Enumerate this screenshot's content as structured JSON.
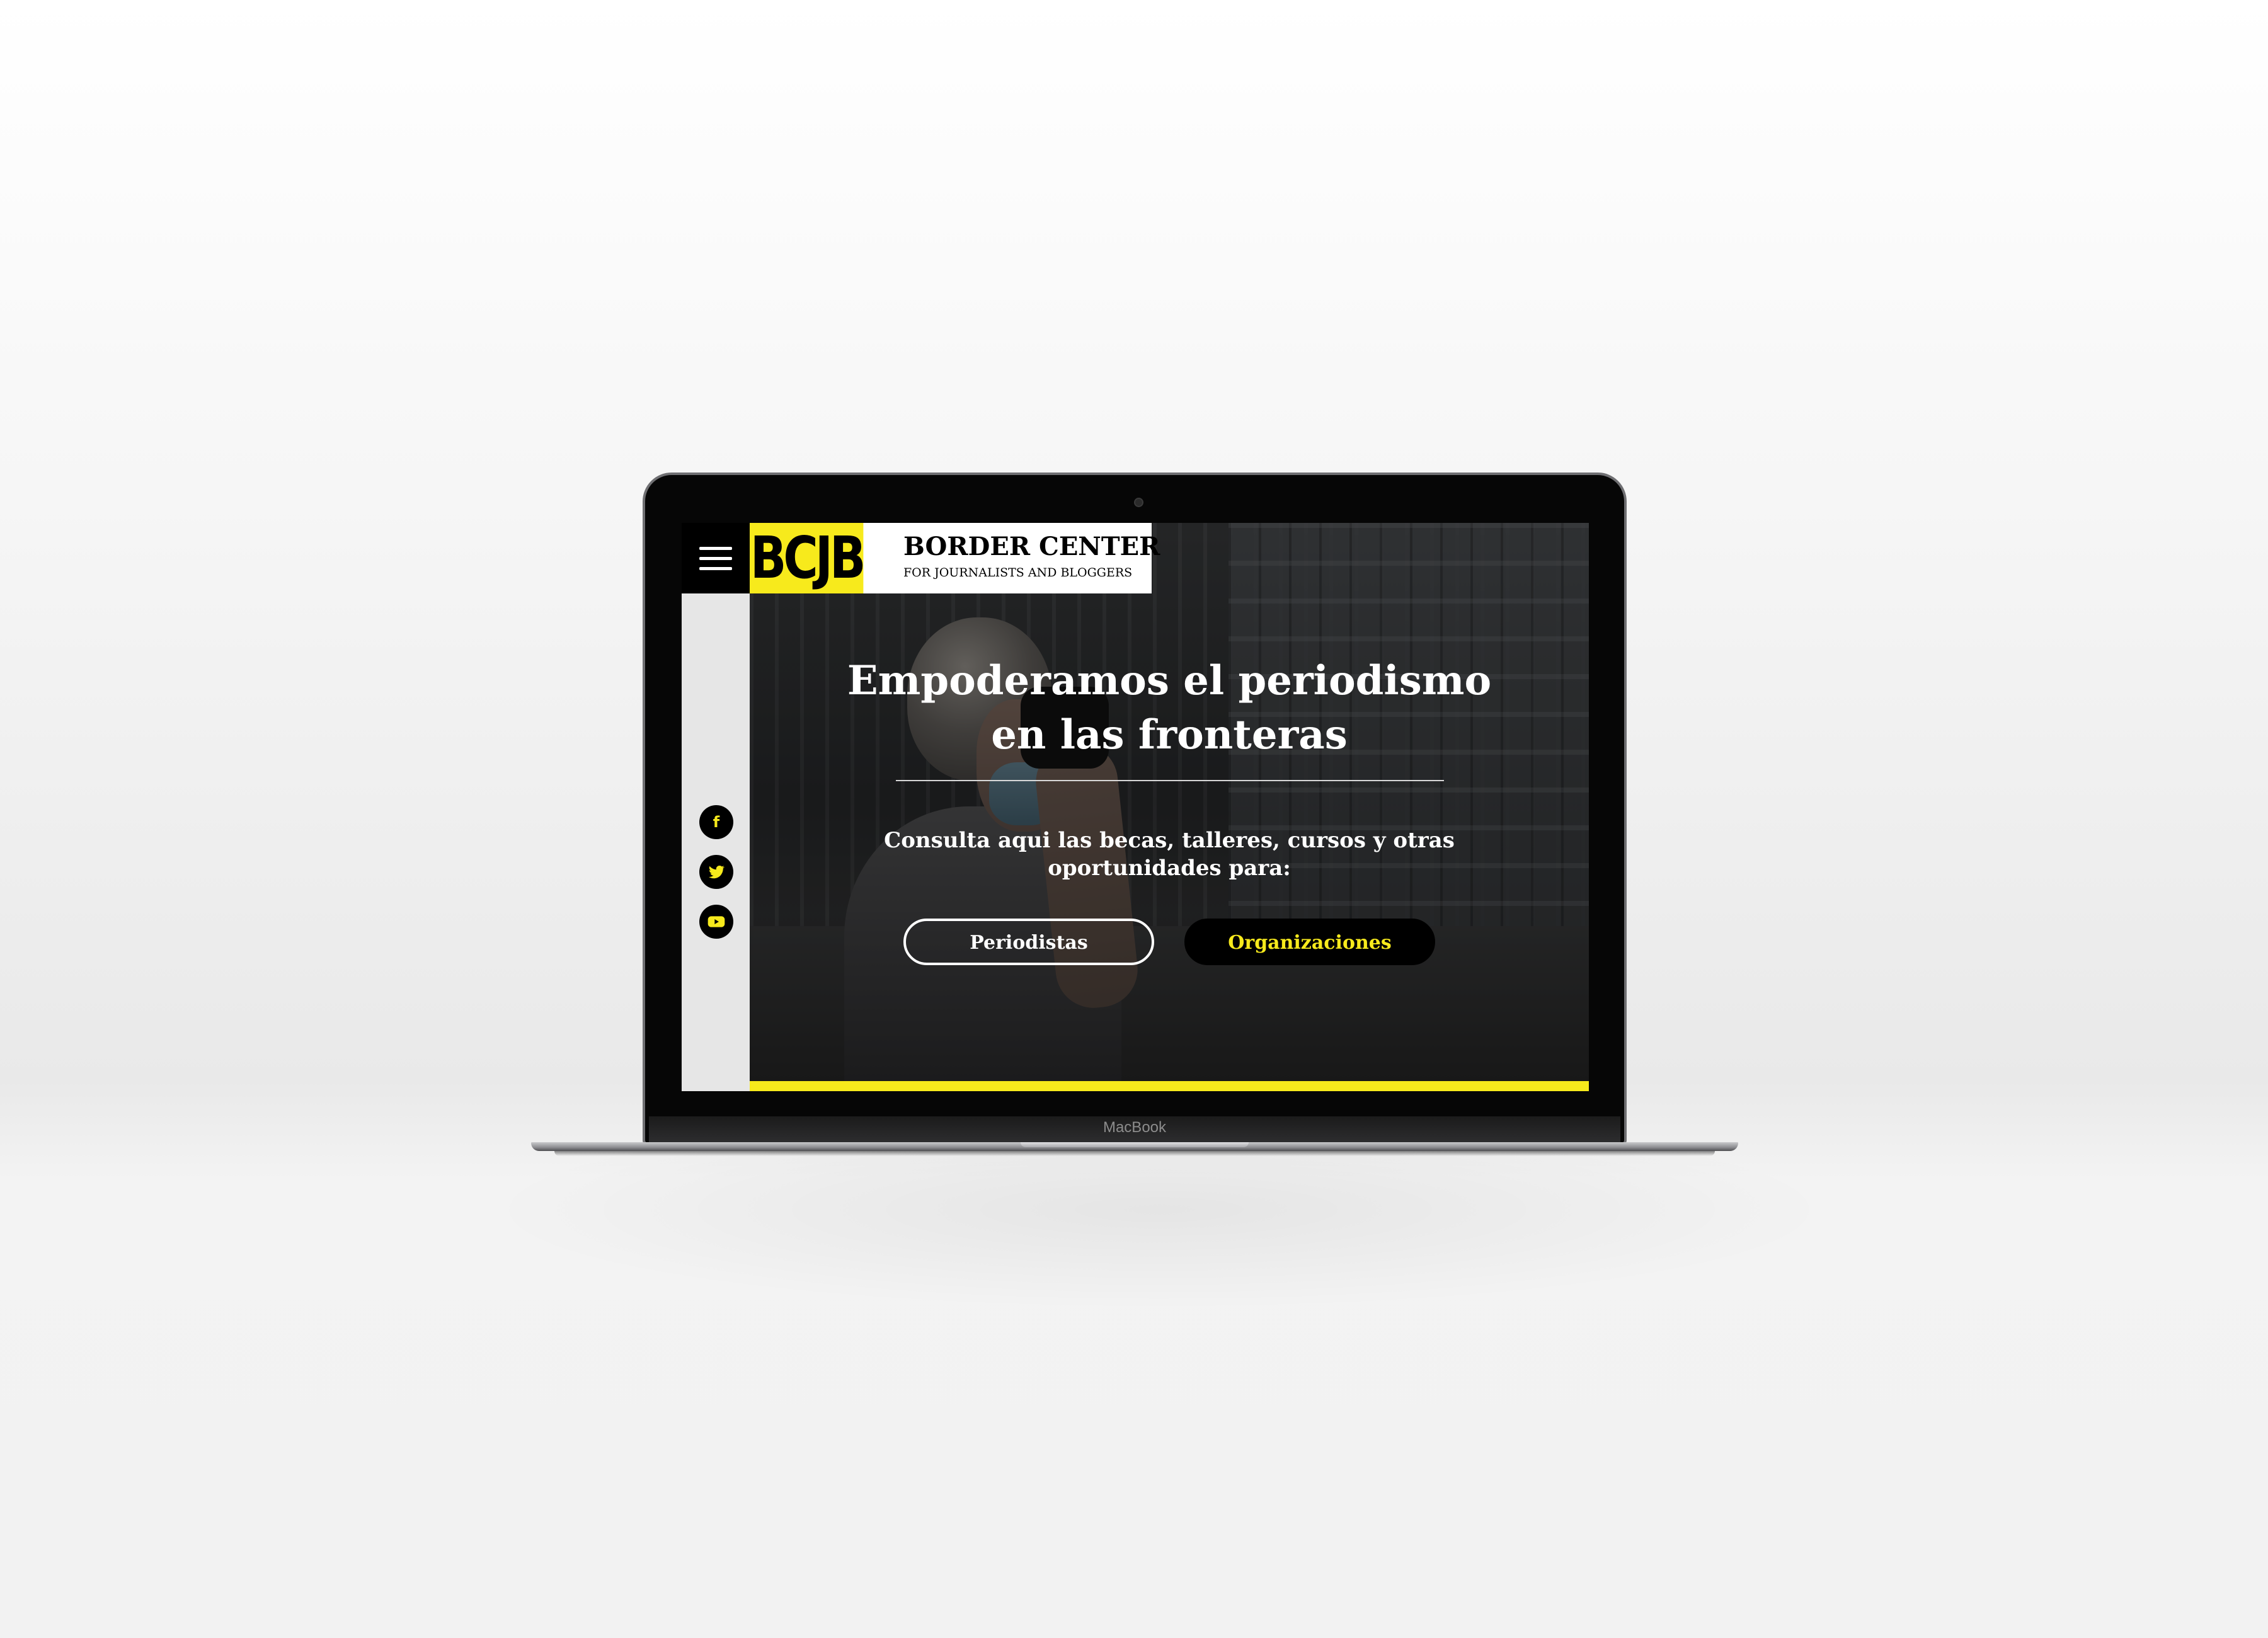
{
  "device": {
    "brand_label": "MacBook"
  },
  "site": {
    "logo_mark": "BCJB",
    "logo_title": "BORDER CENTER",
    "logo_subtitle": "FOR JOURNALISTS AND BLOGGERS",
    "menu_icon": "hamburger-menu-icon",
    "accent_color": "#f7ea1c"
  },
  "hero": {
    "headline_line1": "Empoderamos el periodismo",
    "headline_line2": "en las fronteras",
    "subtext_line1": "Consulta aqui las becas, talleres, cursos y otras",
    "subtext_line2": "oportunidades para:",
    "buttons": {
      "journalists": "Periodistas",
      "organizations": "Organizaciones"
    }
  },
  "social": [
    {
      "icon": "facebook-icon",
      "glyph": "f"
    },
    {
      "icon": "twitter-icon",
      "glyph": ""
    },
    {
      "icon": "youtube-icon",
      "glyph": ""
    }
  ]
}
